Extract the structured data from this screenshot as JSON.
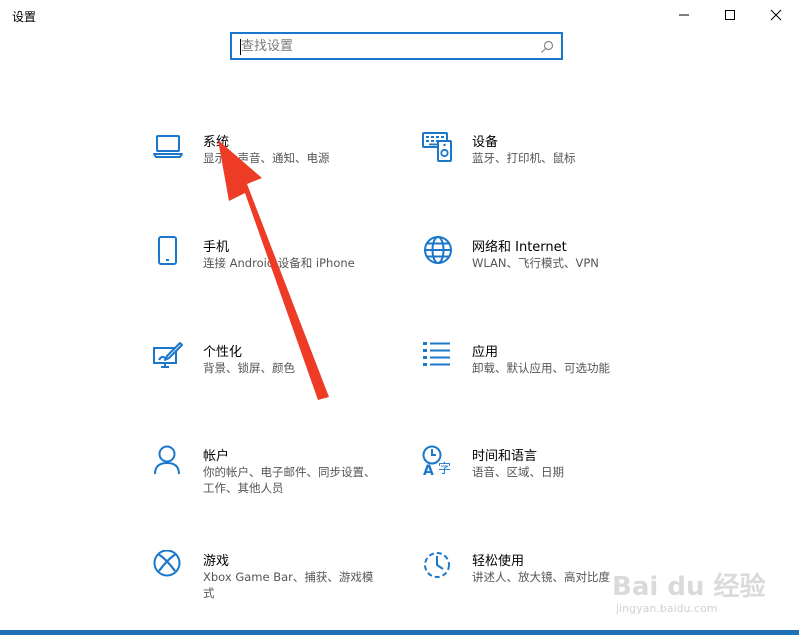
{
  "window": {
    "title": "设置",
    "controls": [
      "minimize-icon",
      "maximize-icon",
      "close-icon"
    ]
  },
  "search": {
    "placeholder": "查找设置",
    "value": "",
    "icon": "search-icon"
  },
  "accent_color": "#1a77c9",
  "tiles": [
    {
      "label": "系统",
      "desc": "显示、声音、通知、电源",
      "icon": "laptop-icon"
    },
    {
      "label": "设备",
      "desc": "蓝牙、打印机、鼠标",
      "icon": "keyboard-icon"
    },
    {
      "label": "手机",
      "desc": "连接 Android 设备和 iPhone",
      "icon": "phone-icon"
    },
    {
      "label": "网络和 Internet",
      "desc": "WLAN、飞行模式、VPN",
      "icon": "globe-icon"
    },
    {
      "label": "个性化",
      "desc": "背景、锁屏、颜色",
      "icon": "paintbrush-icon"
    },
    {
      "label": "应用",
      "desc": "卸载、默认应用、可选功能",
      "icon": "apps-list-icon"
    },
    {
      "label": "帐户",
      "desc": "你的帐户、电子邮件、同步设置、工作、其他人员",
      "icon": "person-icon"
    },
    {
      "label": "时间和语言",
      "desc": "语音、区域、日期",
      "icon": "time-language-icon"
    },
    {
      "label": "游戏",
      "desc": "Xbox Game Bar、捕获、游戏模式",
      "icon": "xbox-icon"
    },
    {
      "label": "轻松使用",
      "desc": "讲述人、放大镜、高对比度",
      "icon": "ease-of-access-icon"
    }
  ],
  "watermark": {
    "text": "Bai du 经验",
    "sub": "jingyan.baidu.com"
  }
}
